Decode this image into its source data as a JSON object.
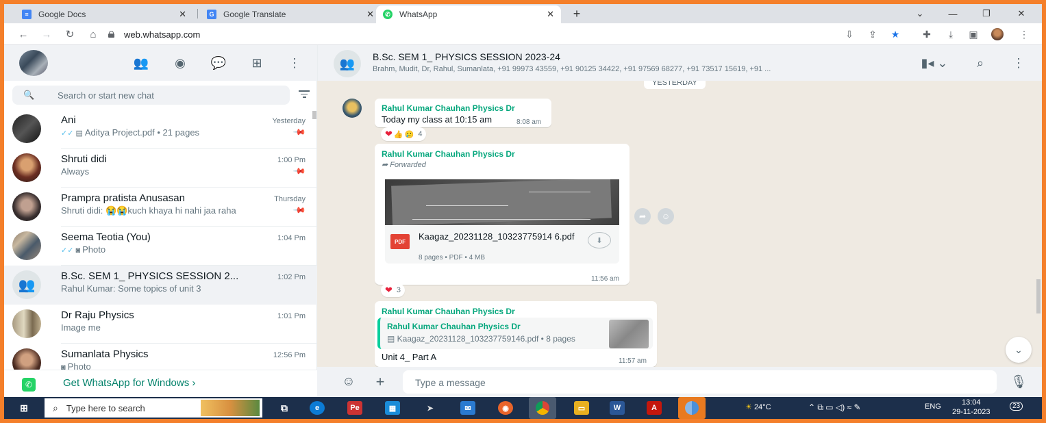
{
  "browser": {
    "tabs": [
      {
        "label": "Google Docs",
        "icon": "google-docs-icon",
        "color": "#4285f4"
      },
      {
        "label": "Google Translate",
        "icon": "google-translate-icon",
        "color": "#4285f4"
      },
      {
        "label": "WhatsApp",
        "icon": "whatsapp-icon",
        "color": "#25d366"
      }
    ],
    "url": "web.whatsapp.com"
  },
  "sidebar": {
    "search_placeholder": "Search or start new chat",
    "chats": [
      {
        "name": "Ani",
        "time": "Yesterday",
        "message": "Aditya Project.pdf • 21 pages",
        "ticks": true,
        "pinned": true
      },
      {
        "name": "Shruti didi",
        "time": "1:00 Pm",
        "message": "Always",
        "pinned": true
      },
      {
        "name": "Prampra pratista Anusasan",
        "time": "Thursday",
        "message": "Shruti didi: 😭😭kuch khaya hi nahi jaa raha",
        "pinned": true
      },
      {
        "name": "Seema Teotia (You)",
        "time": "1:04 Pm",
        "message": "Photo",
        "ticks": true
      },
      {
        "name": "B.Sc. SEM 1_ PHYSICS SESSION 2...",
        "time": "1:02 Pm",
        "message": "Rahul Kumar: Some topics of unit 3",
        "selected": true
      },
      {
        "name": "Dr Raju Physics",
        "time": "1:01 Pm",
        "message": "Image me"
      },
      {
        "name": "Sumanlata Physics",
        "time": "12:56 Pm",
        "message": "Photo"
      }
    ],
    "get_app": "Get WhatsApp for Windows"
  },
  "conversation": {
    "title": "B.Sc. SEM 1_ PHYSICS SESSION 2023-24",
    "members": "Brahm, Mudit, Dr, Rahul, Sumanlata, +91 99973 43559, +91 90125 34422, +91 97569 68277, +91 73517 15619, +91 ...",
    "day_label": "YESTERDAY",
    "messages": [
      {
        "sender": "Rahul Kumar Chauhan Physics Dr",
        "text": "Today my class at 10:15 am",
        "time": "8:08 am",
        "reaction_count": "4"
      },
      {
        "sender": "Rahul Kumar Chauhan Physics Dr",
        "forwarded": "Forwarded",
        "doc_name": "Kaagaz_20231128_10323775914 6.pdf",
        "doc_meta": "8 pages • PDF • 4 MB",
        "time": "11:56 am",
        "reaction_count": "3"
      },
      {
        "sender": "Rahul Kumar Chauhan Physics Dr",
        "quote_sender": "Rahul Kumar Chauhan Physics Dr",
        "quote_text": "Kaagaz_20231128_103237759146.pdf • 8 pages",
        "text": "Unit 4_ Part A",
        "time": "11:57 am"
      }
    ],
    "composer_placeholder": "Type a message"
  },
  "taskbar": {
    "search_placeholder": "Type here to search",
    "weather": "24°C",
    "language": "ENG",
    "time": "13:04",
    "date": "29-11-2023",
    "notifications": "23"
  }
}
